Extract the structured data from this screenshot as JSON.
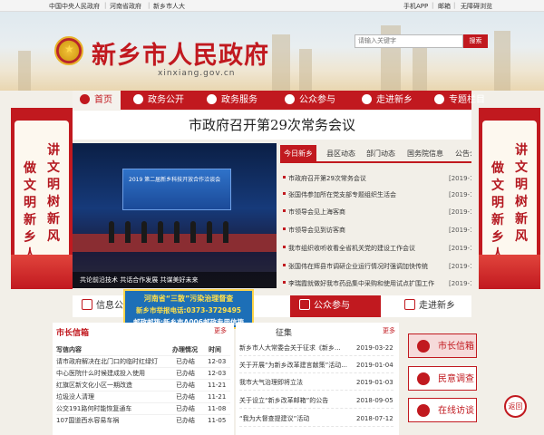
{
  "topbar": {
    "links": [
      "中国中央人民政府",
      "河南省政府",
      "新乡市人大"
    ],
    "right_links": [
      "手机APP",
      "邮箱",
      "无障碍浏览"
    ]
  },
  "header": {
    "title": "新乡市人民政府",
    "domain": "xinxiang.gov.cn",
    "search_placeholder": "请输入关键字",
    "search_button": "搜索"
  },
  "nav": {
    "items": [
      {
        "label": "首页",
        "icon": "home-icon"
      },
      {
        "label": "政务公开",
        "icon": "open-icon"
      },
      {
        "label": "政务服务",
        "icon": "service-icon"
      },
      {
        "label": "公众参与",
        "icon": "participate-icon"
      },
      {
        "label": "走进新乡",
        "icon": "city-icon"
      },
      {
        "label": "专题栏目",
        "icon": "topic-icon"
      }
    ]
  },
  "banners": {
    "left": [
      "讲文明",
      "树新风",
      "做文明",
      "新乡人"
    ],
    "right": [
      "讲文明",
      "树新风",
      "做文明",
      "新乡人"
    ]
  },
  "headline": "市政府召开第29次常务会议",
  "photo": {
    "caption": "共论前沿技术 共话合作发展 共谋美好未来",
    "screen_text": "2019 第二届新乡科技开放合作洽谈会"
  },
  "news": {
    "tabs": [
      "今日新乡",
      "县区动态",
      "部门动态",
      "国务院信息",
      "公告公示"
    ],
    "items": [
      {
        "title": "市政府召开第29次常务会议",
        "date": "[2019-12-"
      },
      {
        "title": "张国伟参加所在党支部专题组织生活会",
        "date": "[2019-12-"
      },
      {
        "title": "市领导会见上海客商",
        "date": "[2019-12-"
      },
      {
        "title": "市领导会见到访客商",
        "date": "[2019-12-"
      },
      {
        "title": "我市组织收听收看全省机关党的建设工作会议",
        "date": "[2019-12-"
      },
      {
        "title": "张国伟在辉县市调研企业运行情况时强调加快传统",
        "date": "[2019-12-"
      },
      {
        "title": "李瑞霞就做好我市药品集中采购和使用试点扩围工作",
        "date": "[2019-12-"
      }
    ]
  },
  "quick": {
    "items": [
      "信息公开",
      "公众参与",
      "走进新乡"
    ]
  },
  "notice": {
    "line1": "河南省“三散”污染治理督查",
    "line2": "新乡市举报电话:0373-3729495",
    "line3": "邮政邮箱:新乡市A006邮政专用信箱"
  },
  "mayor_box": {
    "title": "市长信箱",
    "more": "更多",
    "columns": [
      "写信内容",
      "办理情况",
      "时间"
    ],
    "rows": [
      {
        "content": "请市政府解决在北门口的临时红绿灯",
        "status": "已办结",
        "time": "12-03"
      },
      {
        "content": "中心医院什么时候建成投入使用",
        "status": "已办结",
        "time": "12-03"
      },
      {
        "content": "红旗区新文化小区一期改造",
        "status": "已办结",
        "time": "11-21"
      },
      {
        "content": "垃圾没人清理",
        "status": "已办结",
        "time": "11-21"
      },
      {
        "content": "公交191路何时能恢复通车",
        "status": "已办结",
        "time": "11-08"
      },
      {
        "content": "107国道西水容易车祸",
        "status": "已办结",
        "time": "11-05"
      }
    ]
  },
  "forum": {
    "title": "征集",
    "more": "更多",
    "items": [
      {
        "title": "新乡市人大常委会关于征求《新乡...",
        "date": "2019-03-22"
      },
      {
        "title": "关于开展“为新乡改革建言献策”活动...",
        "date": "2019-01-04"
      },
      {
        "title": "我市大气治理即将立法",
        "date": "2019-01-03"
      },
      {
        "title": "关于设立“新乡改革邮箱”的公告",
        "date": "2018-09-05"
      },
      {
        "title": "“我为大督查提建议”活动",
        "date": "2018-07-12"
      }
    ]
  },
  "services": {
    "items": [
      "市长信箱",
      "民意调查",
      "在线访谈"
    ]
  },
  "back_button": "返回"
}
